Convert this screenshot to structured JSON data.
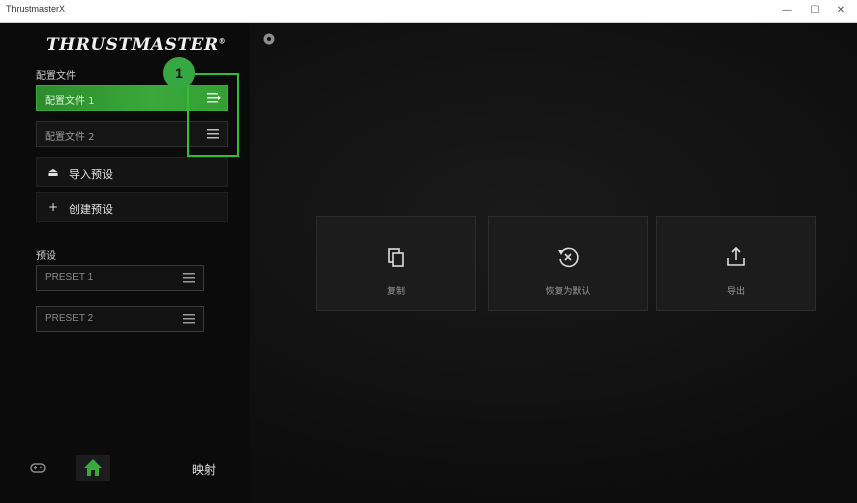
{
  "window": {
    "title": "ThrustmasterX",
    "minimize": "—",
    "maximize": "☐",
    "close": "✕"
  },
  "sidebar": {
    "logo": "THRUSTMASTER",
    "logo_mark": "®",
    "profiles_heading": "配置文件",
    "profiles": [
      {
        "label": "配置文件 1",
        "active": true
      },
      {
        "label": "配置文件 2",
        "active": false
      }
    ],
    "actions": [
      {
        "label": "导入预设",
        "icon": "upload-icon",
        "glyph": "⏏"
      },
      {
        "label": "创建预设",
        "icon": "plus-icon",
        "glyph": "+"
      }
    ],
    "presets_heading": "预设",
    "presets": [
      {
        "label": "PRESET 1"
      },
      {
        "label": "PRESET 2"
      }
    ],
    "bottom_nav": {
      "home_label": "映射"
    }
  },
  "callout": {
    "number": "1",
    "color": "#2fbf2f"
  },
  "main": {
    "cards": [
      {
        "label": "复制",
        "icon": "copy-icon"
      },
      {
        "label": "恢复为默认",
        "icon": "reset-icon"
      },
      {
        "label": "导出",
        "icon": "export-icon"
      }
    ]
  },
  "colors": {
    "accent_green": "#3aa83a",
    "background": "#0e0e0e"
  }
}
